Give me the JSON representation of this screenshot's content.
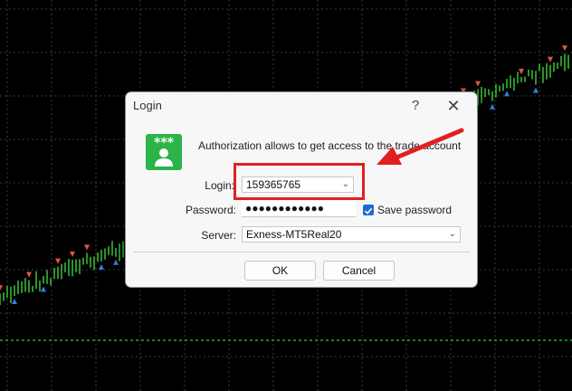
{
  "window": {
    "title": "Login",
    "help_glyph": "?",
    "close_glyph": "✕"
  },
  "dialog": {
    "message": "Authorization allows to get access to the trade account",
    "login_label": "Login:",
    "login_value": "159365765",
    "password_label": "Password:",
    "password_value": "●●●●●●●●●●●●",
    "save_password_label": "Save password",
    "save_password_checked": true,
    "server_label": "Server:",
    "server_value": "Exness-MT5Real20",
    "ok_label": "OK",
    "cancel_label": "Cancel",
    "combo_arrow": "⌄"
  },
  "colors": {
    "accent": "#1f6bd1",
    "annotation": "#e02020",
    "icon_green": "#2bb44a",
    "chart_grid": "#3a3a3a",
    "candle": "#3fd13f",
    "level_line": "#20b020"
  },
  "icons": {
    "app": "user-account-icon",
    "help": "help-icon",
    "close": "close-icon",
    "annotation": "red-arrow-icon"
  }
}
